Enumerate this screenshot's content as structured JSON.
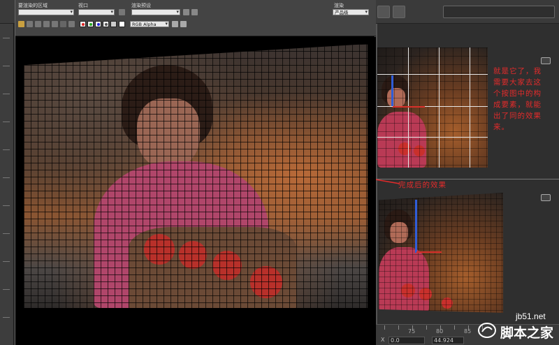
{
  "render_window": {
    "labels": {
      "area_to_render": "要渲染的区域",
      "viewport": "视口",
      "render_preset": "渲染预设",
      "render_button": "渲染"
    },
    "combos": {
      "area_value": "",
      "viewport_value": "",
      "preset_value": "",
      "production_value": "产品级",
      "channel_value": "RGB Alpha"
    }
  },
  "annotations": {
    "note": "就是它了，我需要大家去这个按图中的构成要素，就能出了同的效果来。",
    "arrow_label": "完成后的效果"
  },
  "status": {
    "ruler_ticks": [
      "75",
      "80",
      "85"
    ],
    "coord_x": "0.0",
    "coord_y": "44.924"
  },
  "watermark": {
    "url": "jb51.net",
    "name": "脚本之家"
  },
  "colors": {
    "annotation": "#e32b2b",
    "axis_blue": "#2f5dd8",
    "axis_red": "#d8302a"
  }
}
